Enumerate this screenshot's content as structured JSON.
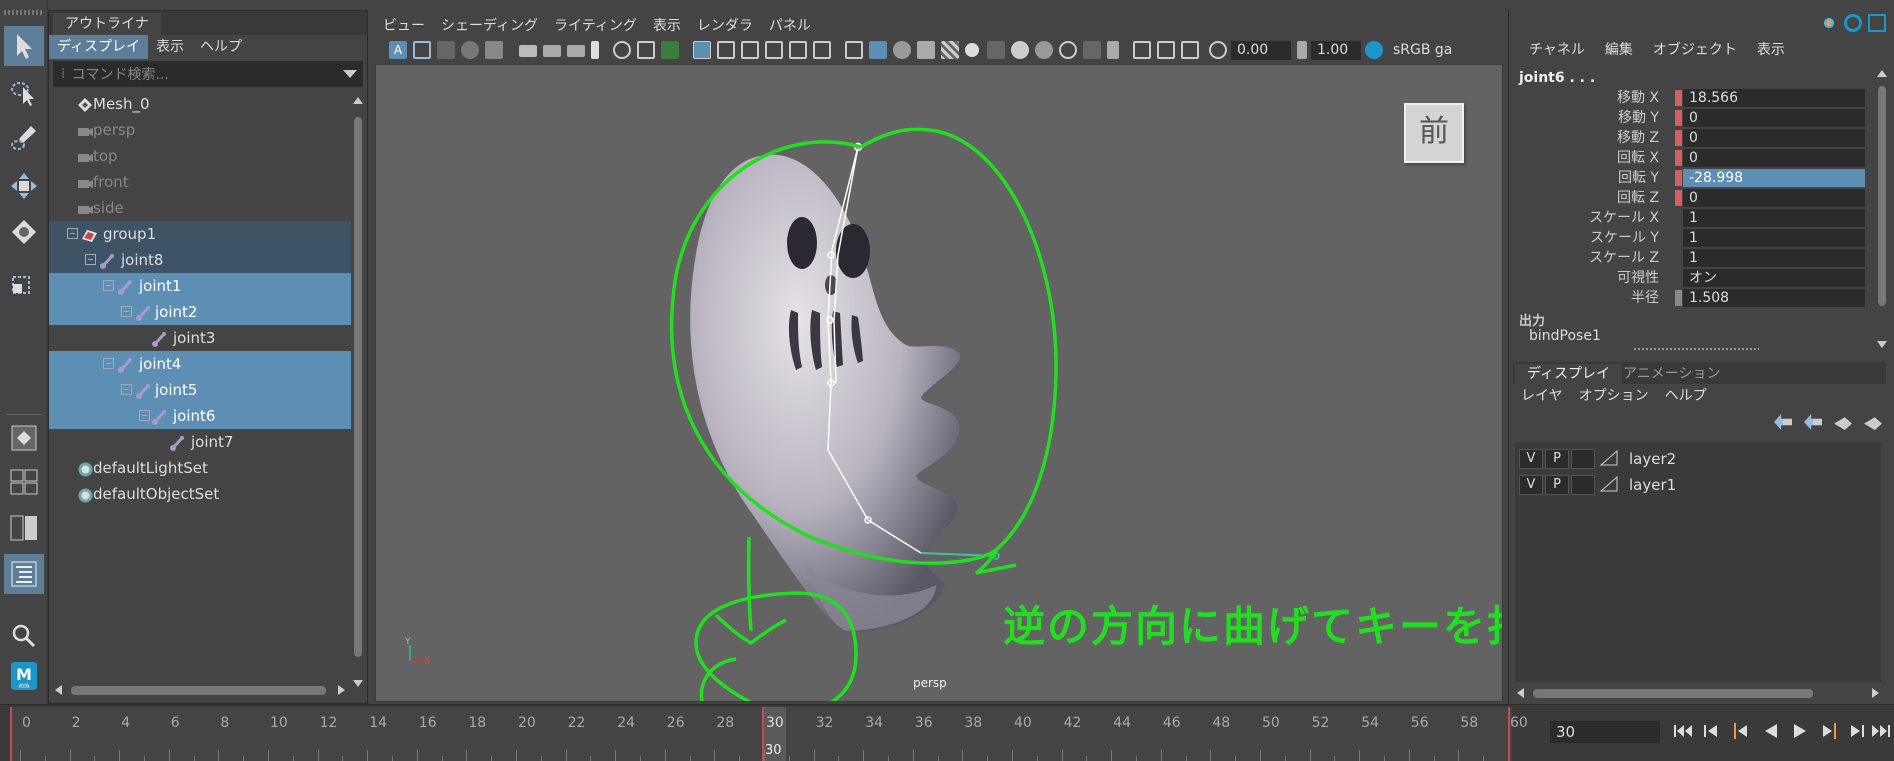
{
  "outliner": {
    "tab": "アウトライナ",
    "menu": [
      "ディスプレイ",
      "表示",
      "ヘルプ"
    ],
    "search_placeholder": "コマンド検索...",
    "items": [
      {
        "label": "Mesh_0",
        "type": "mesh"
      },
      {
        "label": "persp",
        "type": "camera"
      },
      {
        "label": "top",
        "type": "camera"
      },
      {
        "label": "front",
        "type": "camera"
      },
      {
        "label": "side",
        "type": "camera"
      },
      {
        "label": "group1",
        "type": "group"
      },
      {
        "label": "joint8",
        "type": "joint"
      },
      {
        "label": "joint1",
        "type": "joint"
      },
      {
        "label": "joint2",
        "type": "joint"
      },
      {
        "label": "joint3",
        "type": "joint"
      },
      {
        "label": "joint4",
        "type": "joint"
      },
      {
        "label": "joint5",
        "type": "joint"
      },
      {
        "label": "joint6",
        "type": "joint"
      },
      {
        "label": "joint7",
        "type": "joint"
      },
      {
        "label": "defaultLightSet",
        "type": "set"
      },
      {
        "label": "defaultObjectSet",
        "type": "set"
      }
    ]
  },
  "viewport": {
    "menu": [
      "ビュー",
      "シェーディング",
      "ライティング",
      "表示",
      "レンダラ",
      "パネル"
    ],
    "exposure": "0.00",
    "gamma": "1.00",
    "color_space": "sRGB ga",
    "viewcube_label": "前",
    "camera_label": "persp",
    "axis_y": "Y",
    "axis_x": "X",
    "annotation": "逆の方向に曲げてキーを打つ。",
    "annotation_color": "#22dd22"
  },
  "channel_box": {
    "menu": [
      "チャネル",
      "編集",
      "オブジェクト",
      "表示"
    ],
    "object": "joint6 . . .",
    "attributes": [
      {
        "name": "移動 X",
        "value": "18.566"
      },
      {
        "name": "移動 Y",
        "value": "0"
      },
      {
        "name": "移動 Z",
        "value": "0"
      },
      {
        "name": "回転 X",
        "value": "0"
      },
      {
        "name": "回転 Y",
        "value": "-28.998"
      },
      {
        "name": "回転 Z",
        "value": "0"
      },
      {
        "name": "スケール X",
        "value": "1"
      },
      {
        "name": "スケール Y",
        "value": "1"
      },
      {
        "name": "スケール Z",
        "value": "1"
      },
      {
        "name": "可視性",
        "value": "オン"
      },
      {
        "name": "半径",
        "value": "1.508"
      }
    ],
    "outputs_label": "出力",
    "output_node": "bindPose1"
  },
  "layer_editor": {
    "tabs": [
      "ディスプレイ",
      "アニメーション"
    ],
    "menu": [
      "レイヤ",
      "オプション",
      "ヘルプ"
    ],
    "layers": [
      {
        "v": "V",
        "p": "P",
        "name": "layer2"
      },
      {
        "v": "V",
        "p": "P",
        "name": "layer1"
      }
    ]
  },
  "timeline": {
    "labels": [
      "0",
      "2",
      "4",
      "6",
      "8",
      "10",
      "12",
      "14",
      "16",
      "18",
      "20",
      "22",
      "24",
      "26",
      "28",
      "30",
      "32",
      "34",
      "36",
      "38",
      "40",
      "42",
      "44",
      "46",
      "48",
      "50",
      "52",
      "54",
      "56",
      "58",
      "60"
    ],
    "current_frame": "30",
    "current_frame_field": "30"
  },
  "tools": [
    "select-tool",
    "lasso-tool",
    "paint-select-tool",
    "move-tool",
    "rotate-tool",
    "scale-tool",
    "single-view-layout",
    "four-view-layout",
    "outliner-layout",
    "search",
    "maya-logo"
  ],
  "colors": {
    "selection": "#5d8fb4",
    "accent_red": "#d35f5f"
  }
}
